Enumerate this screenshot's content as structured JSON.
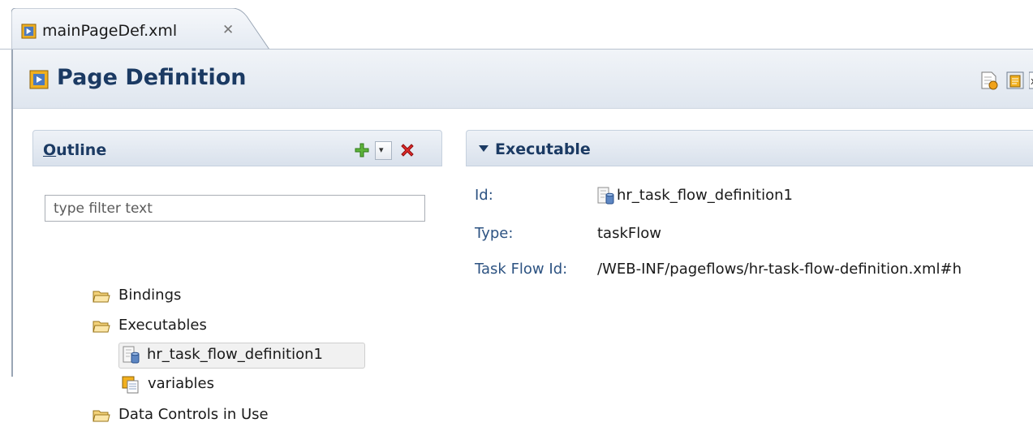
{
  "editor_tab": {
    "title": "mainPageDef.xml",
    "close_symbol": "✕"
  },
  "page": {
    "title": "Page Definition",
    "header_buttons": [
      "page-definition-icon",
      "source-icon",
      "xml-icon"
    ]
  },
  "outline": {
    "title_underlined": "O",
    "title_rest": "utline",
    "add_button": "plus-icon",
    "dropdown_button": "▾",
    "delete_button": "red-x-icon",
    "filter_placeholder": "type filter text",
    "tree": [
      {
        "label": "Bindings",
        "icon": "folder-icon",
        "level": 0
      },
      {
        "label": "Executables",
        "icon": "folder-icon",
        "level": 0
      },
      {
        "label": "hr_task_flow_definition1",
        "icon": "task-flow-icon",
        "level": 1,
        "selected": true
      },
      {
        "label": "variables",
        "icon": "variables-icon",
        "level": 1
      },
      {
        "label": "Data Controls in Use",
        "icon": "folder-icon",
        "level": 0
      }
    ]
  },
  "executable": {
    "title": "Executable",
    "properties": [
      {
        "label": "Id:",
        "value": "hr_task_flow_definition1",
        "icon": "task-flow-icon"
      },
      {
        "label": "Type:",
        "value": "taskFlow"
      },
      {
        "label": "Task Flow Id:",
        "value": "/WEB-INF/pageflows/hr-task-flow-definition.xml#h"
      }
    ]
  },
  "colors": {
    "header_text": "#1b3a63",
    "label_text": "#2d5382",
    "header_bg_top": "#f1f4f8",
    "header_bg_bottom": "#dfe6ef"
  }
}
